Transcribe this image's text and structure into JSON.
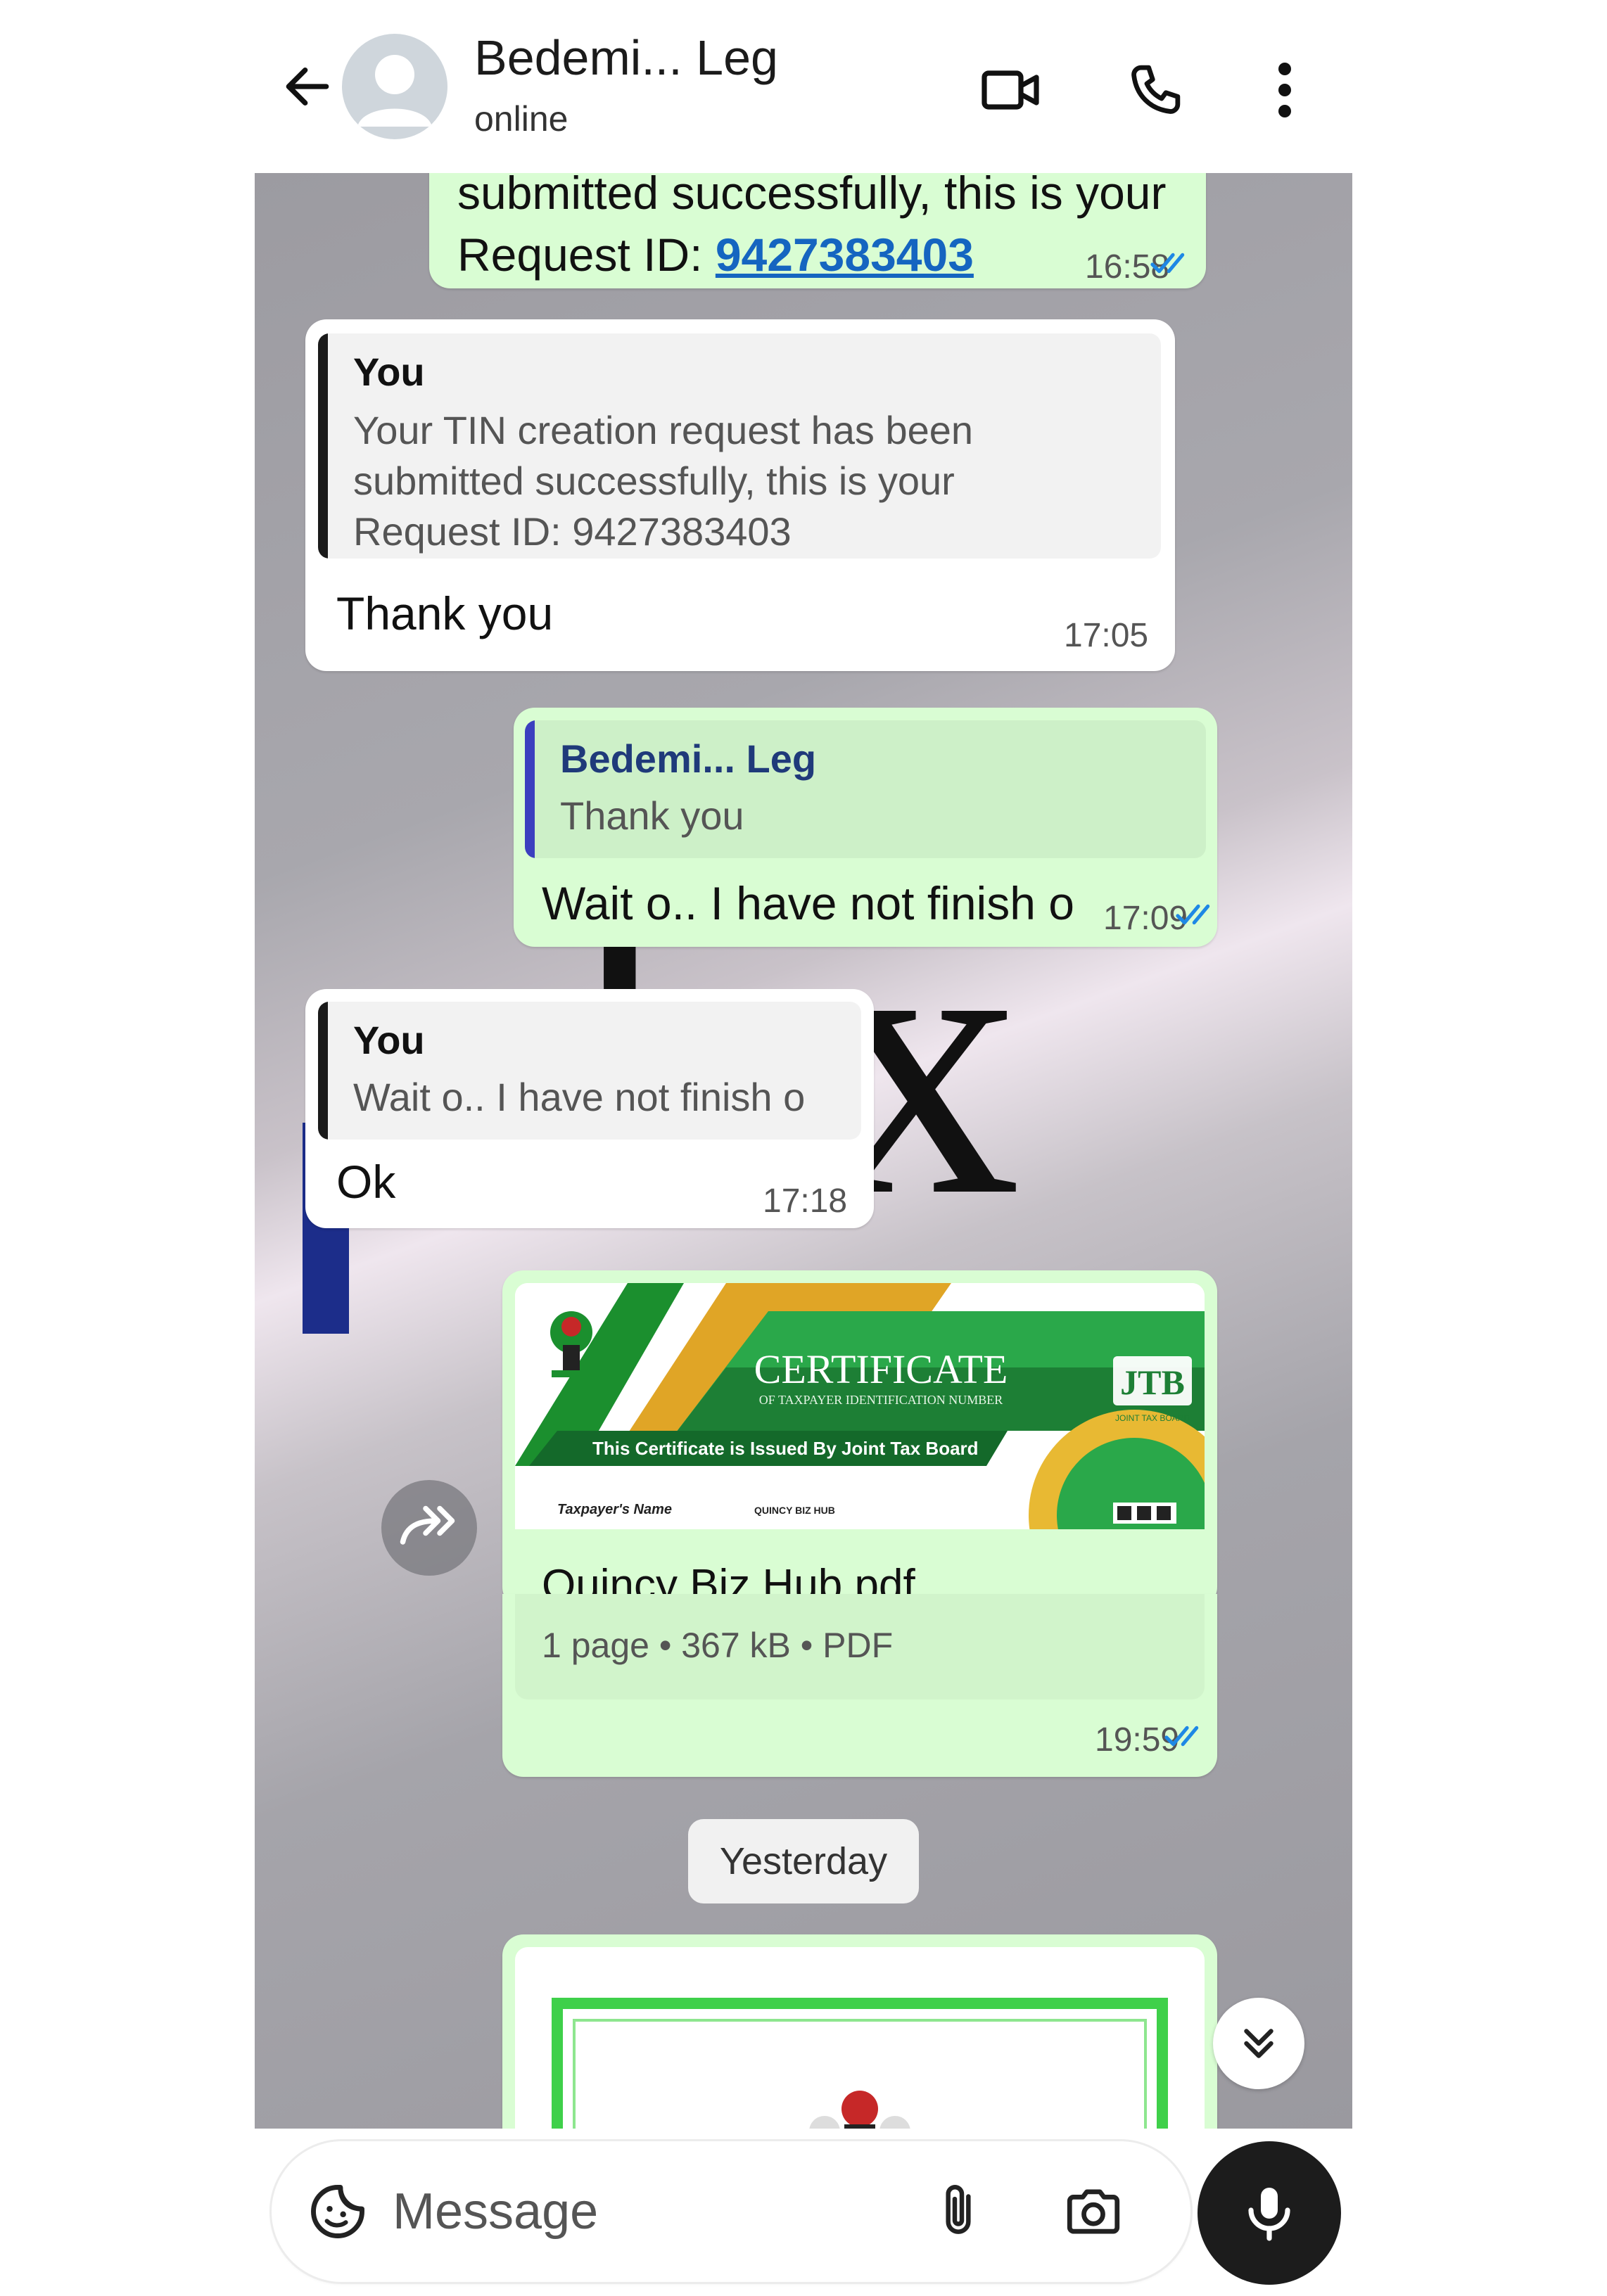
{
  "header": {
    "contact_name": "Bedemi... Leg",
    "status": "online"
  },
  "messages": {
    "m1": {
      "partial_line": "submitted successfully, this is your",
      "request_label": "Request ID: ",
      "request_id": "9427383403",
      "time": "16:58"
    },
    "m2": {
      "quote_author": "You",
      "quote_text": "Your TIN creation request has been\nsubmitted successfully, this is your\nRequest ID: 9427383403",
      "text": "Thank you",
      "time": "17:05"
    },
    "m3": {
      "quote_author": "Bedemi... Leg",
      "quote_text": "Thank you",
      "text": "Wait o.. I have not finish o",
      "time": "17:09"
    },
    "m4": {
      "quote_author": "You",
      "quote_text": "Wait o.. I have not finish o",
      "text": "Ok",
      "time": "17:18"
    },
    "m5": {
      "preview": {
        "title": "CERTIFICATE",
        "subtitle": "OF TAXPAYER IDENTIFICATION NUMBER",
        "issued": "This Certificate is Issued By Joint Tax Board",
        "logo": "JTB",
        "logo_sub": "JOINT TAX BOARD",
        "field_label": "Taxpayer's Name",
        "field_value": "QUINCY BIZ HUB"
      },
      "file_name": "Quincy Biz Hub.pdf",
      "file_meta": "1 page • 367 kB • PDF",
      "time": "19:59"
    }
  },
  "date_chip": "Yesterday",
  "composer": {
    "placeholder": "Message"
  },
  "colors": {
    "outgoing_bubble": "#d9fdd3",
    "incoming_bubble": "#ffffff",
    "read_ticks": "#1e88e5",
    "link": "#1565c0",
    "mic_button": "#1c1c1c"
  }
}
